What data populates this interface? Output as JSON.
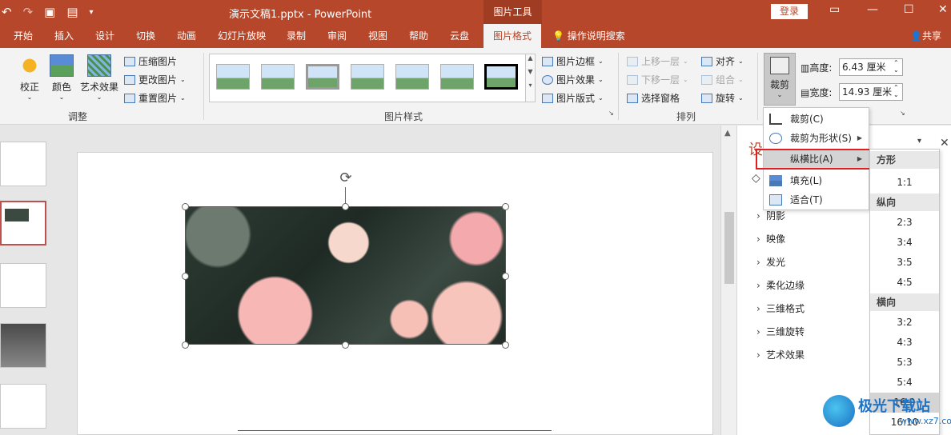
{
  "titlebar": {
    "doc_title": "演示文稿1.pptx  -  PowerPoint",
    "context_tab": "图片工具",
    "login": "登录",
    "qat_icons": [
      "undo-icon",
      "redo-icon",
      "slideshow-icon",
      "print-preview-icon",
      "customize-qat-icon"
    ]
  },
  "tabs": [
    "开始",
    "插入",
    "设计",
    "切换",
    "动画",
    "幻灯片放映",
    "录制",
    "审阅",
    "视图",
    "帮助",
    "云盘",
    "图片格式"
  ],
  "active_tab": "图片格式",
  "tell_me": "操作说明搜索",
  "share": "共享",
  "ribbon": {
    "adjust": {
      "corrections": "校正",
      "color": "颜色",
      "artistic": "艺术效果",
      "compress": "压缩图片",
      "change": "更改图片",
      "reset": "重置图片",
      "group_label": "调整"
    },
    "styles": {
      "border": "图片边框",
      "effects": "图片效果",
      "layout": "图片版式",
      "group_label": "图片样式"
    },
    "arrange": {
      "bring_forward": "上移一层",
      "send_backward": "下移一层",
      "selection_pane": "选择窗格",
      "align": "对齐",
      "group": "组合",
      "rotate": "旋转",
      "group_label": "排列"
    },
    "size": {
      "crop": "裁剪",
      "height_label": "高度:",
      "height_value": "6.43 厘米",
      "width_label": "宽度:",
      "width_value": "14.93 厘米"
    }
  },
  "crop_menu": [
    {
      "label": "裁剪(C)",
      "icon": "crop-icon",
      "submenu": false
    },
    {
      "label": "裁剪为形状(S)",
      "icon": "shape-icon",
      "submenu": true
    },
    {
      "label": "纵横比(A)",
      "icon": "",
      "submenu": true
    },
    {
      "label": "填充(L)",
      "icon": "fill-icon",
      "submenu": false
    },
    {
      "label": "适合(T)",
      "icon": "fit-icon",
      "submenu": false
    }
  ],
  "aspect_submenu": {
    "square_header": "方形",
    "square": [
      "1:1"
    ],
    "portrait_header": "纵向",
    "portrait": [
      "2:3",
      "3:4",
      "3:5",
      "4:5"
    ],
    "landscape_header": "横向",
    "landscape": [
      "3:2",
      "4:3",
      "5:3",
      "5:4",
      "16:9",
      "16:10"
    ]
  },
  "format_pane": {
    "title": "设",
    "sections": [
      "阴影",
      "映像",
      "发光",
      "柔化边缘",
      "三维格式",
      "三维旋转",
      "艺术效果"
    ]
  },
  "watermark": {
    "text": "极光下载站",
    "url": "www.xz7.com"
  }
}
